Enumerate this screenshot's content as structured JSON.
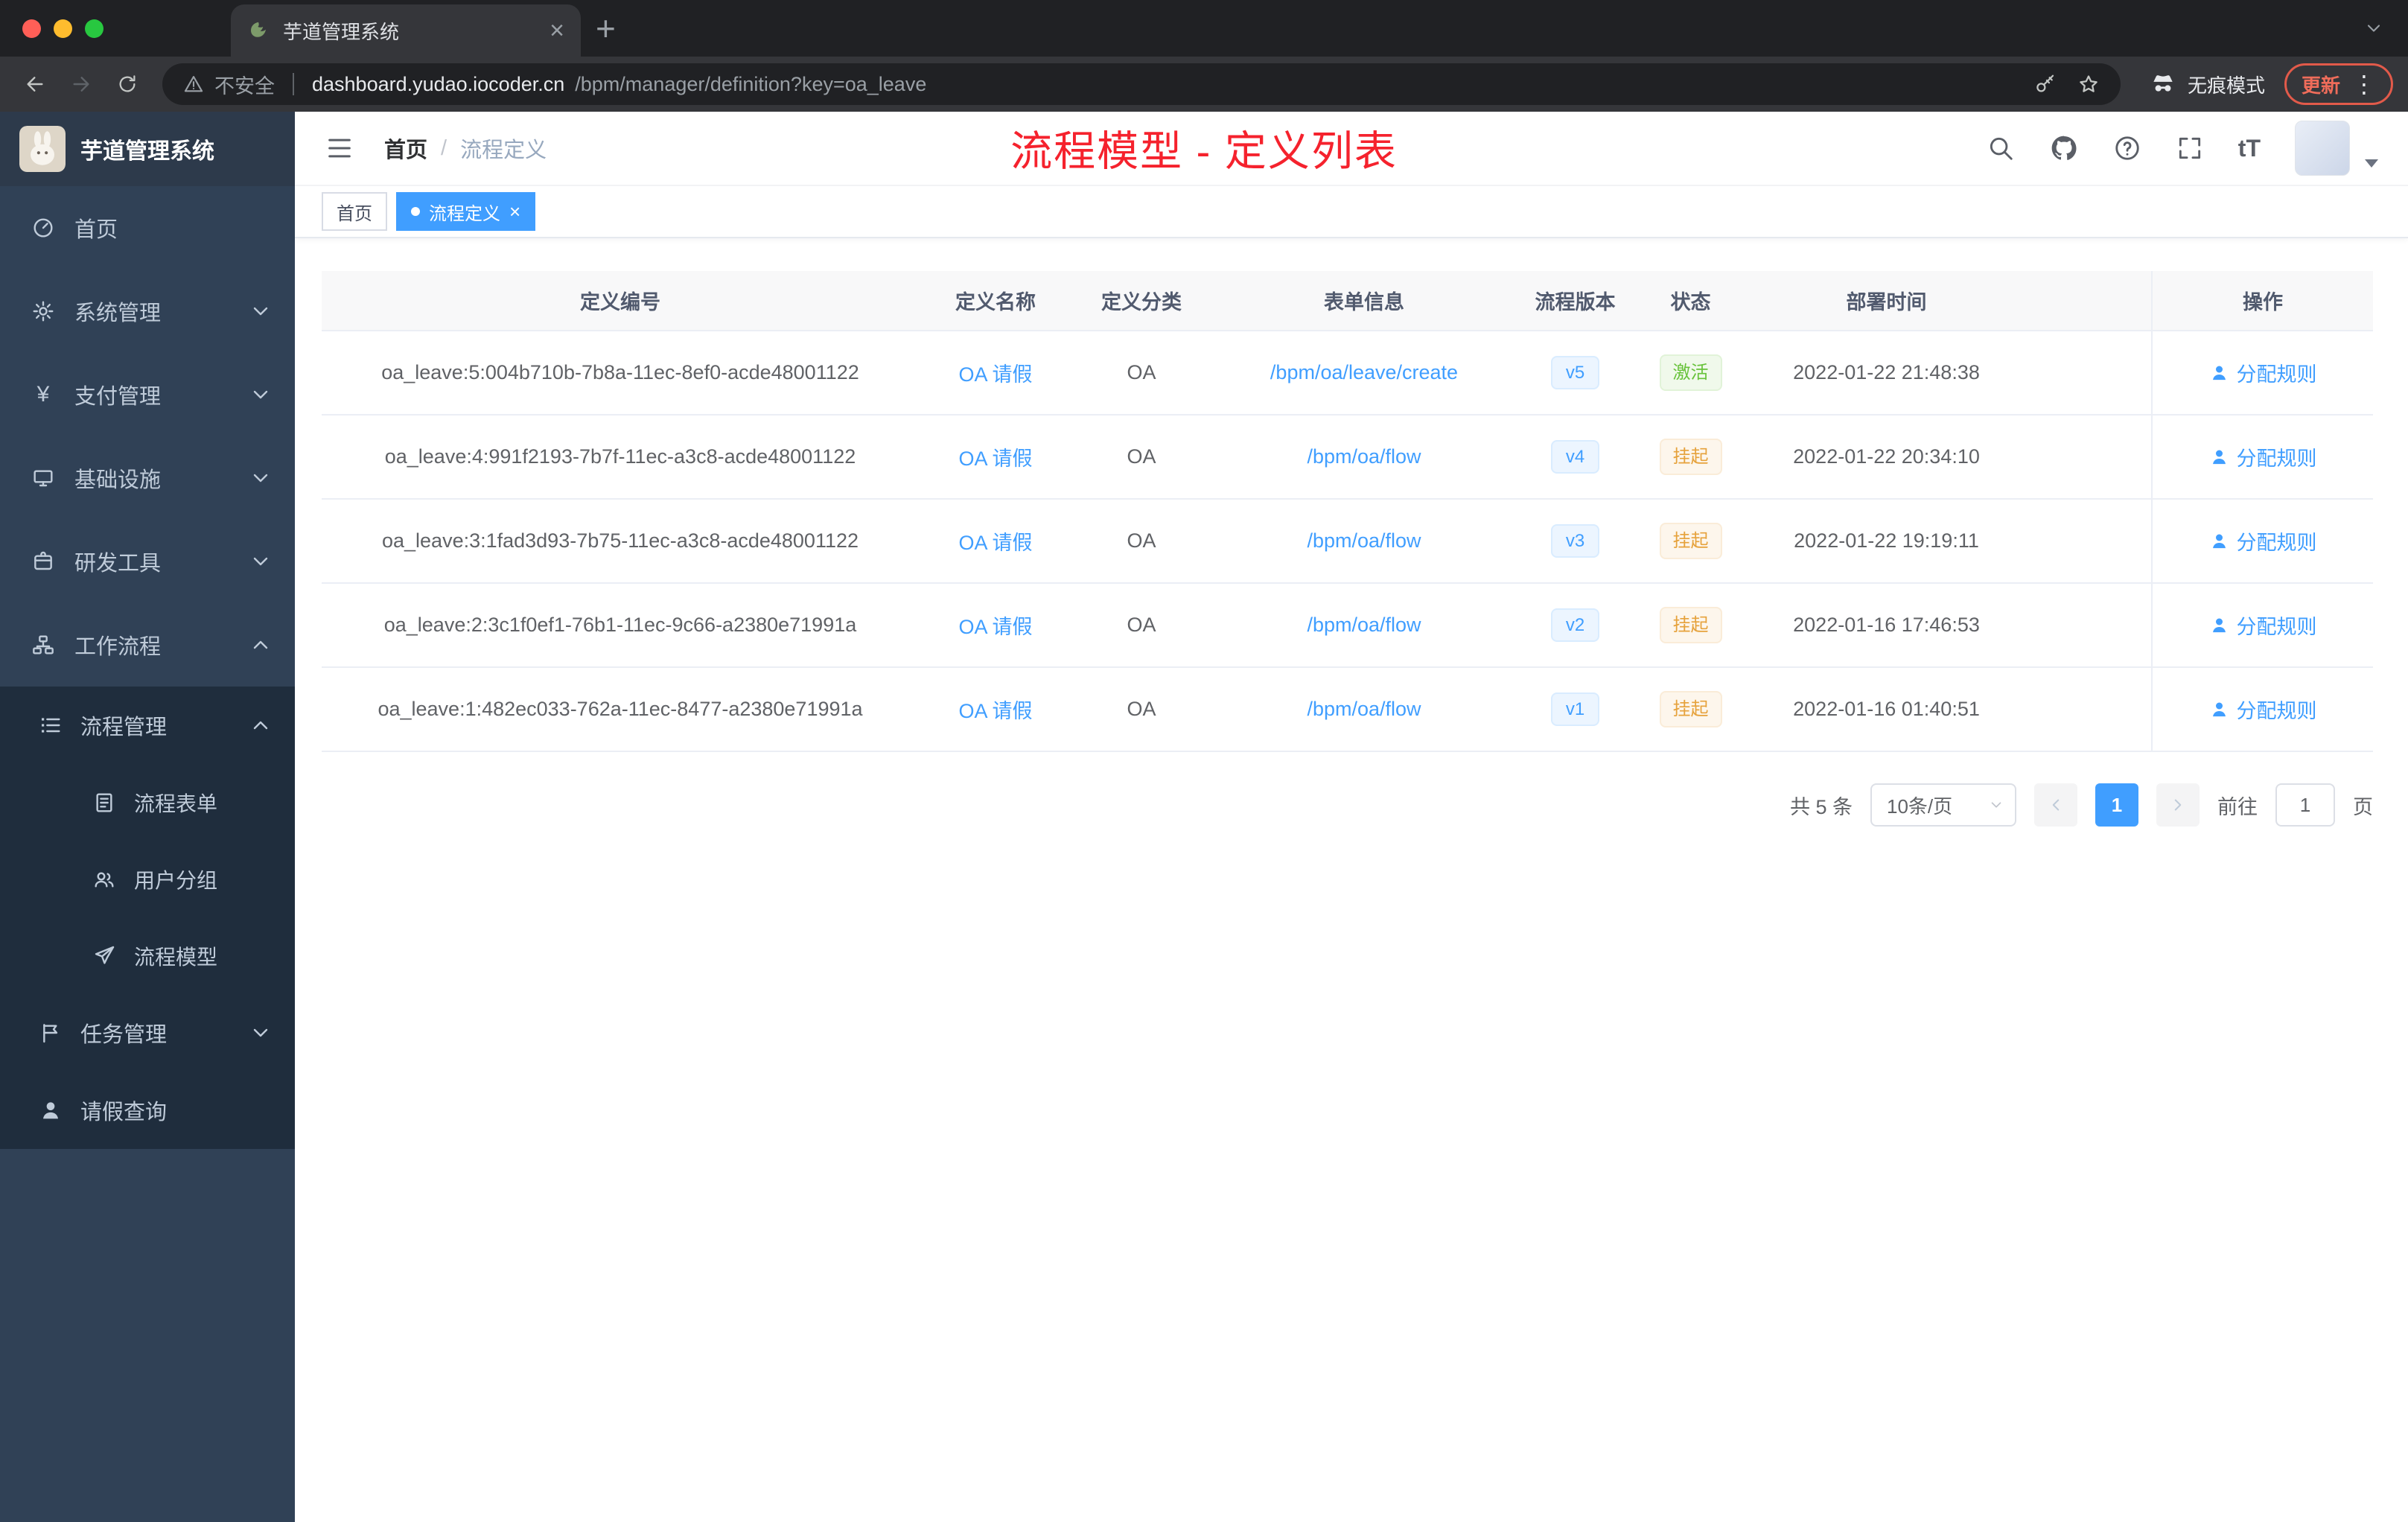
{
  "colors": {
    "accent": "#409eff",
    "success": "#67c23a",
    "warning": "#e6a23c",
    "annotation_red": "#f5222d",
    "sidebar_bg": "#304156",
    "sidebar_submenu_bg": "#1f2d3d"
  },
  "browser": {
    "tab_title": "芋道管理系统",
    "security_label": "不安全",
    "url_host": "dashboard.yudao.iocoder.cn",
    "url_path": "/bpm/manager/definition?key=oa_leave",
    "incognito_label": "无痕模式",
    "update_label": "更新"
  },
  "sidebar": {
    "logo_title": "芋道管理系统",
    "items": [
      {
        "label": "首页",
        "icon": "dashboard-icon"
      },
      {
        "label": "系统管理",
        "icon": "gear-icon"
      },
      {
        "label": "支付管理",
        "icon": "yen-icon"
      },
      {
        "label": "基础设施",
        "icon": "monitor-icon"
      },
      {
        "label": "研发工具",
        "icon": "toolbox-icon"
      },
      {
        "label": "工作流程",
        "icon": "workflow-icon"
      },
      {
        "label": "流程管理",
        "icon": "list-icon"
      },
      {
        "label": "流程表单",
        "icon": "form-icon"
      },
      {
        "label": "用户分组",
        "icon": "users-icon"
      },
      {
        "label": "流程模型",
        "icon": "paper-plane-icon"
      },
      {
        "label": "任务管理",
        "icon": "flag-icon"
      },
      {
        "label": "请假查询",
        "icon": "user-icon"
      }
    ]
  },
  "header": {
    "breadcrumb_home": "首页",
    "breadcrumb_sep": "/",
    "breadcrumb_current": "流程定义",
    "annotation": "流程模型 - 定义列表"
  },
  "tags": {
    "home": "首页",
    "current": "流程定义",
    "close": "×"
  },
  "table": {
    "columns": [
      "定义编号",
      "定义名称",
      "定义分类",
      "表单信息",
      "流程版本",
      "状态",
      "部署时间",
      "操作"
    ],
    "rows": [
      {
        "id": "oa_leave:5:004b710b-7b8a-11ec-8ef0-acde48001122",
        "name": "OA 请假",
        "category": "OA",
        "form": "/bpm/oa/leave/create",
        "version": "v5",
        "status": "激活",
        "status_type": "success",
        "deploy_time": "2022-01-22 21:48:38",
        "action": "分配规则"
      },
      {
        "id": "oa_leave:4:991f2193-7b7f-11ec-a3c8-acde48001122",
        "name": "OA 请假",
        "category": "OA",
        "form": "/bpm/oa/flow",
        "version": "v4",
        "status": "挂起",
        "status_type": "warning",
        "deploy_time": "2022-01-22 20:34:10",
        "action": "分配规则"
      },
      {
        "id": "oa_leave:3:1fad3d93-7b75-11ec-a3c8-acde48001122",
        "name": "OA 请假",
        "category": "OA",
        "form": "/bpm/oa/flow",
        "version": "v3",
        "status": "挂起",
        "status_type": "warning",
        "deploy_time": "2022-01-22 19:19:11",
        "action": "分配规则"
      },
      {
        "id": "oa_leave:2:3c1f0ef1-76b1-11ec-9c66-a2380e71991a",
        "name": "OA 请假",
        "category": "OA",
        "form": "/bpm/oa/flow",
        "version": "v2",
        "status": "挂起",
        "status_type": "warning",
        "deploy_time": "2022-01-16 17:46:53",
        "action": "分配规则"
      },
      {
        "id": "oa_leave:1:482ec033-762a-11ec-8477-a2380e71991a",
        "name": "OA 请假",
        "category": "OA",
        "form": "/bpm/oa/flow",
        "version": "v1",
        "status": "挂起",
        "status_type": "warning",
        "deploy_time": "2022-01-16 01:40:51",
        "action": "分配规则"
      }
    ]
  },
  "pagination": {
    "total": "共 5 条",
    "page_size": "10条/页",
    "current_page": "1",
    "goto_label": "前往",
    "goto_value": "1",
    "goto_unit": "页"
  }
}
